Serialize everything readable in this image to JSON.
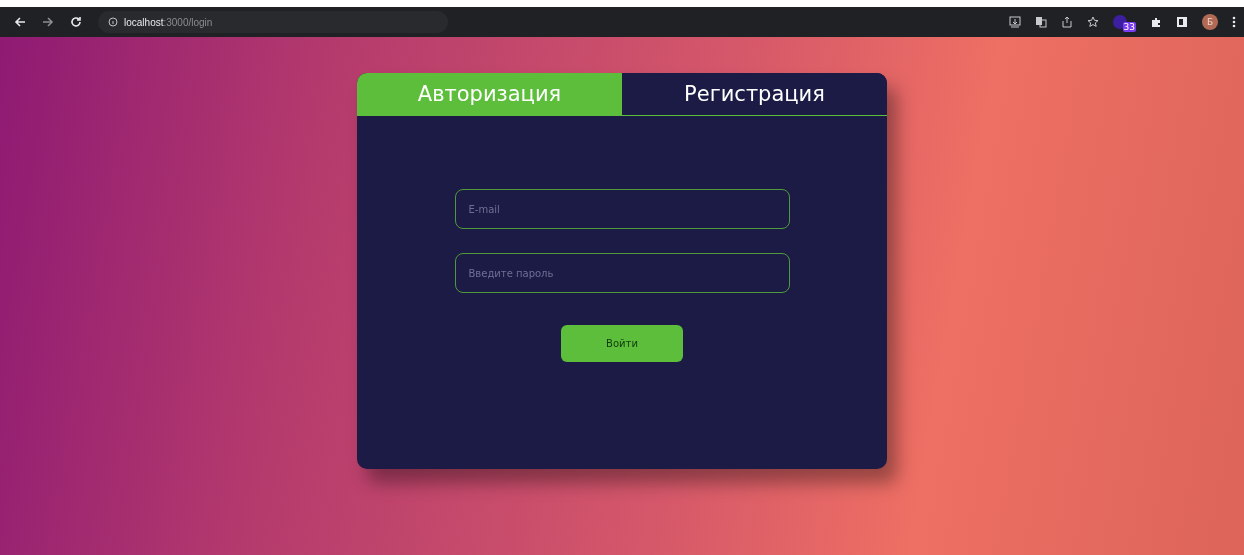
{
  "browser": {
    "url_host": "localhost",
    "url_path": ":3000/login",
    "profile_initial": "Б",
    "extension_badge": "33"
  },
  "tabs": [
    {
      "label": "Авторизация",
      "selected": true
    },
    {
      "label": "Регистрация",
      "selected": false
    }
  ],
  "fields": [
    {
      "placeholder": "E-mail"
    },
    {
      "placeholder": "Введите пароль"
    }
  ],
  "submit": {
    "label": "Войти"
  }
}
